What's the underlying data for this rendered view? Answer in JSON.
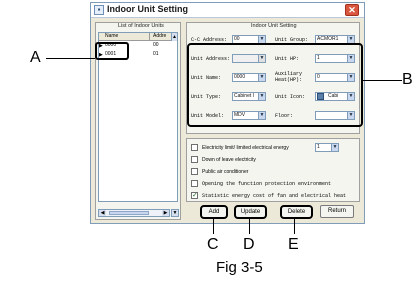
{
  "window": {
    "title": "Indoor Unit Setting",
    "close_icon": "close-icon"
  },
  "left_panel": {
    "caption": "List of Indoor Units",
    "columns": [
      "Name",
      "Addre"
    ],
    "rows": [
      {
        "name": "0000",
        "address": "00"
      },
      {
        "name": "0001",
        "address": "01"
      }
    ]
  },
  "setting_panel": {
    "caption": "Indoor Unit Setting",
    "fields": {
      "cc_address": {
        "label": "C-C Address:",
        "value": "00"
      },
      "unit_group": {
        "label": "Unit Group:",
        "value": "ACMOR1"
      },
      "unit_address": {
        "label": "Unit Address:",
        "value": ""
      },
      "unit_hp": {
        "label": "Unit HP:",
        "value": "1"
      },
      "unit_name": {
        "label": "Unit Name:",
        "value": "0000"
      },
      "aux_heat": {
        "label": "Auxiliary Heat(HP):",
        "value": "0"
      },
      "unit_type": {
        "label": "Unit Type:",
        "value": "Cabinet I"
      },
      "unit_icon": {
        "label": "Unit Icon:",
        "value": "Cabi"
      },
      "unit_model": {
        "label": "Unit Model:",
        "value": "MDV"
      },
      "floor": {
        "label": "Floor:",
        "value": ""
      }
    }
  },
  "options": [
    {
      "label": "Electricity limit/ limited electrical energy",
      "checked": false,
      "value": "1"
    },
    {
      "label": "Down of leave electricity",
      "checked": false
    },
    {
      "label": "Public air conditioner",
      "checked": false
    },
    {
      "label": "Opening the function protection environment",
      "checked": false
    },
    {
      "label": "Statistic energy cost of fan and electrical heat",
      "checked": true
    }
  ],
  "buttons": {
    "add": "Add",
    "update": "Update",
    "delete": "Delete",
    "return": "Return"
  },
  "callouts": {
    "a": "A",
    "b": "B",
    "c": "C",
    "d": "D",
    "e": "E"
  },
  "figure_caption": "Fig 3-5"
}
